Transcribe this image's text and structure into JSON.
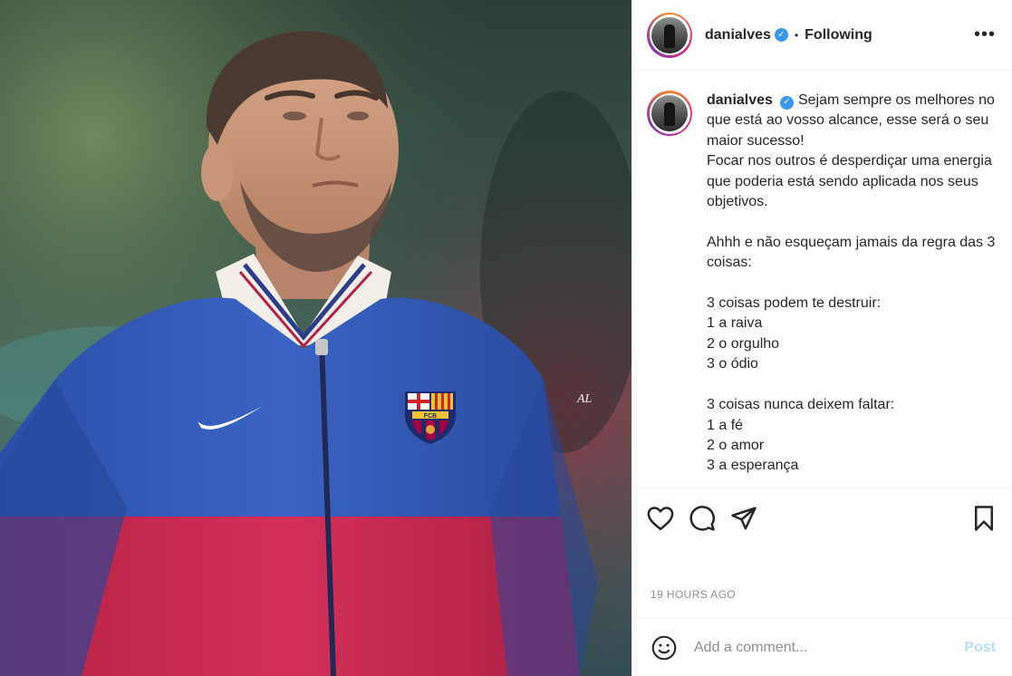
{
  "post": {
    "username": "danialves",
    "verified_label": "✓",
    "follow_status": "Following",
    "more_label": "•••",
    "caption": "Sejam sempre os melhores no que está ao vosso alcance, esse será o seu maior sucesso!\nFocar nos outros é desperdiçar uma energia que poderia está sendo aplicada nos seus objetivos.\n\nAhhh e não esqueçam jamais da regra das 3 coisas:\n\n3 coisas podem te destruir:\n1 a raiva\n2 o orgulho\n3 o ódio\n\n3 coisas nunca deixem faltar:\n1 a fé\n2 o amor\n3 a esperança",
    "timestamp": "19 HOURS AGO",
    "watermark": "AL"
  },
  "comment_box": {
    "placeholder": "Add a comment...",
    "post_label": "Post"
  },
  "icons": {
    "like": "heart-icon",
    "comment": "comment-icon",
    "share": "share-icon",
    "save": "bookmark-icon",
    "emoji": "emoji-icon",
    "more": "more-options-icon"
  },
  "colors": {
    "verified": "#3897f0",
    "post_button": "#b2dffc",
    "muted_text": "#8e8e8e",
    "jacket_blue": "#2f56b5",
    "jacket_red": "#c8294f"
  }
}
